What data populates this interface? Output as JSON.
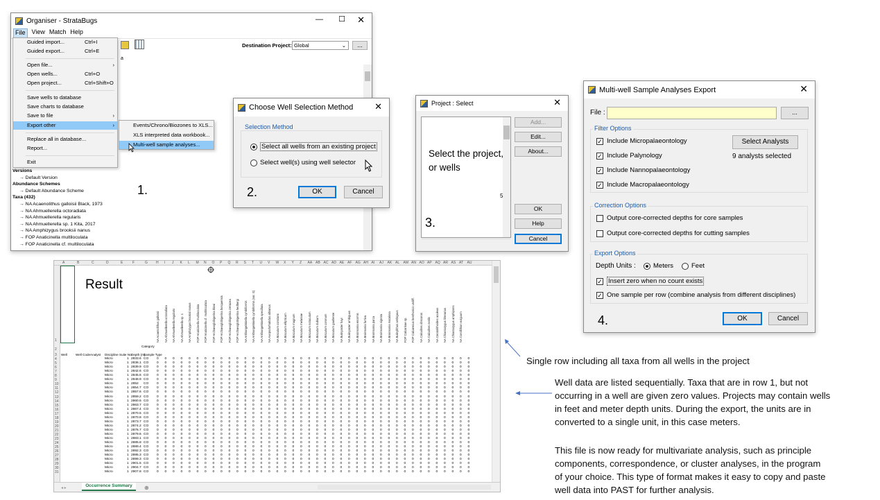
{
  "organiser": {
    "title": "Organiser - StrataBugs",
    "menu": [
      "File",
      "View",
      "Match",
      "Help"
    ],
    "dest_label": "Destination Project:",
    "dest_value": "Global",
    "dest_btn": "...",
    "stub": "a",
    "file_menu": [
      {
        "label": "Guided import...",
        "sc": "Ctrl+I"
      },
      {
        "label": "Guided export...",
        "sc": "Ctrl+E"
      },
      {
        "label": "Open file...",
        "sc": "",
        "ar": "›"
      },
      {
        "label": "Open wells...",
        "sc": "Ctrl+O"
      },
      {
        "label": "Open project...",
        "sc": "Ctrl+Shift+O"
      },
      {
        "label": "Save wells to database",
        "sc": ""
      },
      {
        "label": "Save charts to database",
        "sc": ""
      },
      {
        "label": "Save to file",
        "sc": "",
        "ar": "›"
      },
      {
        "label": "Export other",
        "sc": "",
        "ar": "›"
      },
      {
        "label": "Replace all in database...",
        "sc": ""
      },
      {
        "label": "Report...",
        "sc": ""
      },
      {
        "label": "Exit",
        "sc": ""
      }
    ],
    "submenu": [
      "Events/Chrono/Biozones to XLS...",
      "XLS interpreted data workbook...",
      "Multi-well sample analyses..."
    ],
    "tree": [
      "Versions",
      "→ Default Version",
      "Abundance Schemes",
      "→ Default Abundance Scheme",
      "Taxa (432)",
      "→ NA   Acaenolithus galloisii Black, 1973",
      "→ NA   Ahmuellerella octoradiata",
      "→ NA   Ahmuellerella regularis",
      "→ NA   Ahmuellerella sp. 1 Kita, 2017",
      "→ NA   Amphizygus brooksii nanus",
      "→ FOP   Anaticinella multiloculata",
      "→ FOP   Anaticinella cf. multiloculata"
    ]
  },
  "step_numbers": [
    "1.",
    "2.",
    "3.",
    "4."
  ],
  "choose": {
    "title": "Choose Well Selection Method",
    "group": "Selection Method",
    "opt1": "Select all wells from an existing project",
    "opt2": "Select well(s) using well selector",
    "ok": "OK",
    "cancel": "Cancel"
  },
  "project": {
    "title": "Project : Select",
    "add": "Add...",
    "edit": "Edit...",
    "about": "About...",
    "ok": "OK",
    "help": "Help",
    "cancel": "Cancel",
    "hint": "Select the project, or wells",
    "stub": "5"
  },
  "export": {
    "title": "Multi-well Sample Analyses Export",
    "file_label": "File :",
    "file_btn": "...",
    "filter_title": "Filter Options",
    "filters": [
      "Include Micropalaeontology",
      "Include Palynology",
      "Include Nannopalaeontology",
      "Include Macropalaeontology"
    ],
    "select_analysts": "Select Analysts",
    "analysts_selected": "9 analysts selected",
    "correction_title": "Correction Options",
    "corrections": [
      "Output core-corrected depths for core samples",
      "Output core-corrected depths for cutting samples"
    ],
    "export_title": "Export Options",
    "depth_units": "Depth Units :",
    "meters": "Meters",
    "feet": "Feet",
    "exports": [
      "Insert zero when no count exists",
      "One sample per row (combine analysis from different disciplines)"
    ],
    "ok": "OK",
    "cancel": "Cancel"
  },
  "sheet": {
    "result": "Result",
    "tab": "Occurrence Summary",
    "cols": [
      "A",
      "B",
      "C",
      "D",
      "E",
      "F",
      "G",
      "H",
      "I",
      "J",
      "K",
      "L",
      "M",
      "N",
      "O",
      "P",
      "Q",
      "R",
      "S",
      "T",
      "U",
      "V",
      "W",
      "X",
      "Y",
      "Z",
      "AA",
      "AB",
      "AC",
      "AD",
      "AE",
      "AF",
      "AG",
      "AH",
      "AI",
      "AJ",
      "AK",
      "AL",
      "AM",
      "AN",
      "AO",
      "AP",
      "AQ",
      "AR",
      "AS",
      "AT",
      "AU"
    ],
    "headers": [
      "Well",
      "Well Code",
      "Analyst",
      "Discipline",
      "Suite No.",
      "Depth (m)",
      "Sample Type"
    ],
    "category": "Category",
    "taxa": [
      "NA  Acaenolithus galloisii",
      "NA  Ahmuellerella octoradiata",
      "NA  Ahmuellerella regularis",
      "NA  Ahmuellerella sp. 1",
      "NA  Amphizygus brooksii nanus",
      "FOP  Anaticinella multiloculata",
      "FOP  Anaticinella cf. multiloculata",
      "FOP  Archaeoglobigerina blowi",
      "FOP  Archaeoglobigerina bosquensis",
      "FOP  Archaeoglobigerina cretacea",
      "FOP  Archaeoglobigerina hedbergi",
      "NA  Arkhangelskiella cymbiformis",
      "NA  Arkhangelskiella cymbiformis (var. S)",
      "NA  Arkhangelskiella specillata",
      "NA  Axopodorhabdus albianus",
      "NA  Biscutum constans",
      "NA  Biscutum ellipticum",
      "NA  Biscutum magnum",
      "NA  Biscutum melaniae",
      "NA  Biscutum notaculum",
      "NA  Biscutum dubium",
      "NA  Biscutum coronum",
      "NA  Biscutum gaultense",
      "NA  Bukryaster hayi",
      "NA  Bukryaster ambiguus",
      "NA  Broinsonia enormis",
      "NA  Broinsonia furtiva",
      "NA  Broinsonia parca",
      "NA  Broinsonia signata",
      "NA  Broinsonia matalosa",
      "NA  Bukrylithus ambiguus",
      "FOP  Calcarinae sp.",
      "FOP  Calcareous benthonics undiff.",
      "NA  Calculites obscurus",
      "NA  Calculites ovalis",
      "NA  Ceratolithoides aculeus",
      "NA  Chiastozygus litterarius",
      "NA  Chiastozygus amphipons",
      "NA  Corollithion exiguum"
    ],
    "depths": [
      "2833.6",
      "2836.1",
      "2839.9",
      "2842.6",
      "2845.6",
      "2848.9",
      "2852",
      "2854.7",
      "2857.6",
      "2859.2",
      "2860.6",
      "2863.7",
      "2867.4",
      "2870.5",
      "2870.8",
      "2873.7",
      "2874.2",
      "2876.7",
      "2879.6",
      "2883.1",
      "2885.8",
      "2889.4",
      "2892.3",
      "2895.3",
      "2899.3",
      "2901.5",
      "2904.7",
      "2907.8"
    ]
  },
  "notes": {
    "arrow1": "Single row including all taxa from all wells in the project",
    "para1": [
      "Well data are listed sequentially. Taxa that are in row 1, but not",
      "occurring in a well are given zero values. Projects may contain wells",
      "in feet and meter depth units. During the export, the units are in",
      "converted to a single unit, in this case meters."
    ],
    "para2": [
      "This file is now ready for multivariate analysis, such as principle",
      "components, correspondence, or cluster analyses, in the program",
      "of your choice. This type of format makes it easy to copy and paste",
      "well data into PAST for further analysis."
    ]
  }
}
